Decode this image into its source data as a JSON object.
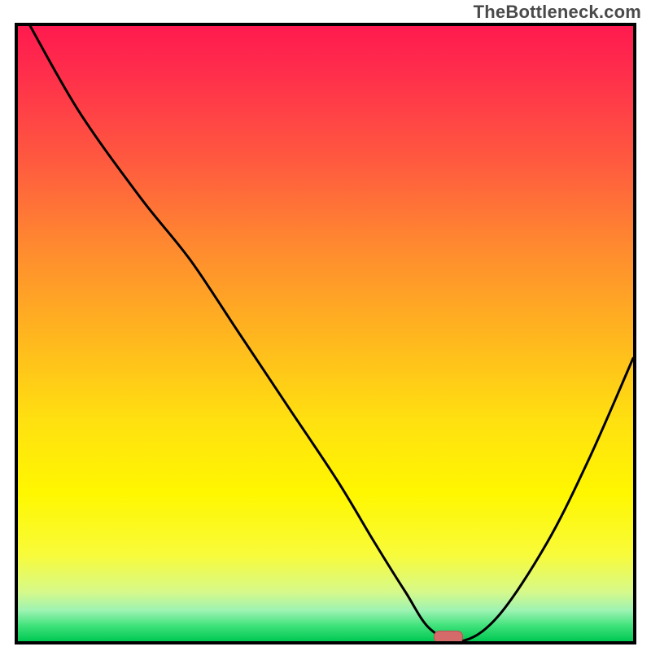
{
  "watermark": "TheBottleneck.com",
  "chart_data": {
    "type": "line",
    "title": "",
    "xlabel": "",
    "ylabel": "",
    "x": [
      0.02,
      0.1,
      0.2,
      0.28,
      0.36,
      0.44,
      0.52,
      0.58,
      0.63,
      0.67,
      0.72,
      0.78,
      0.86,
      0.93,
      1.0
    ],
    "values": [
      1.0,
      0.86,
      0.72,
      0.62,
      0.5,
      0.38,
      0.26,
      0.16,
      0.08,
      0.02,
      0.0,
      0.04,
      0.16,
      0.3,
      0.46
    ],
    "xlim": [
      0,
      1
    ],
    "ylim": [
      0,
      1
    ],
    "marker": {
      "x": 0.7,
      "y": 0.0
    },
    "background": "heat-gradient"
  }
}
